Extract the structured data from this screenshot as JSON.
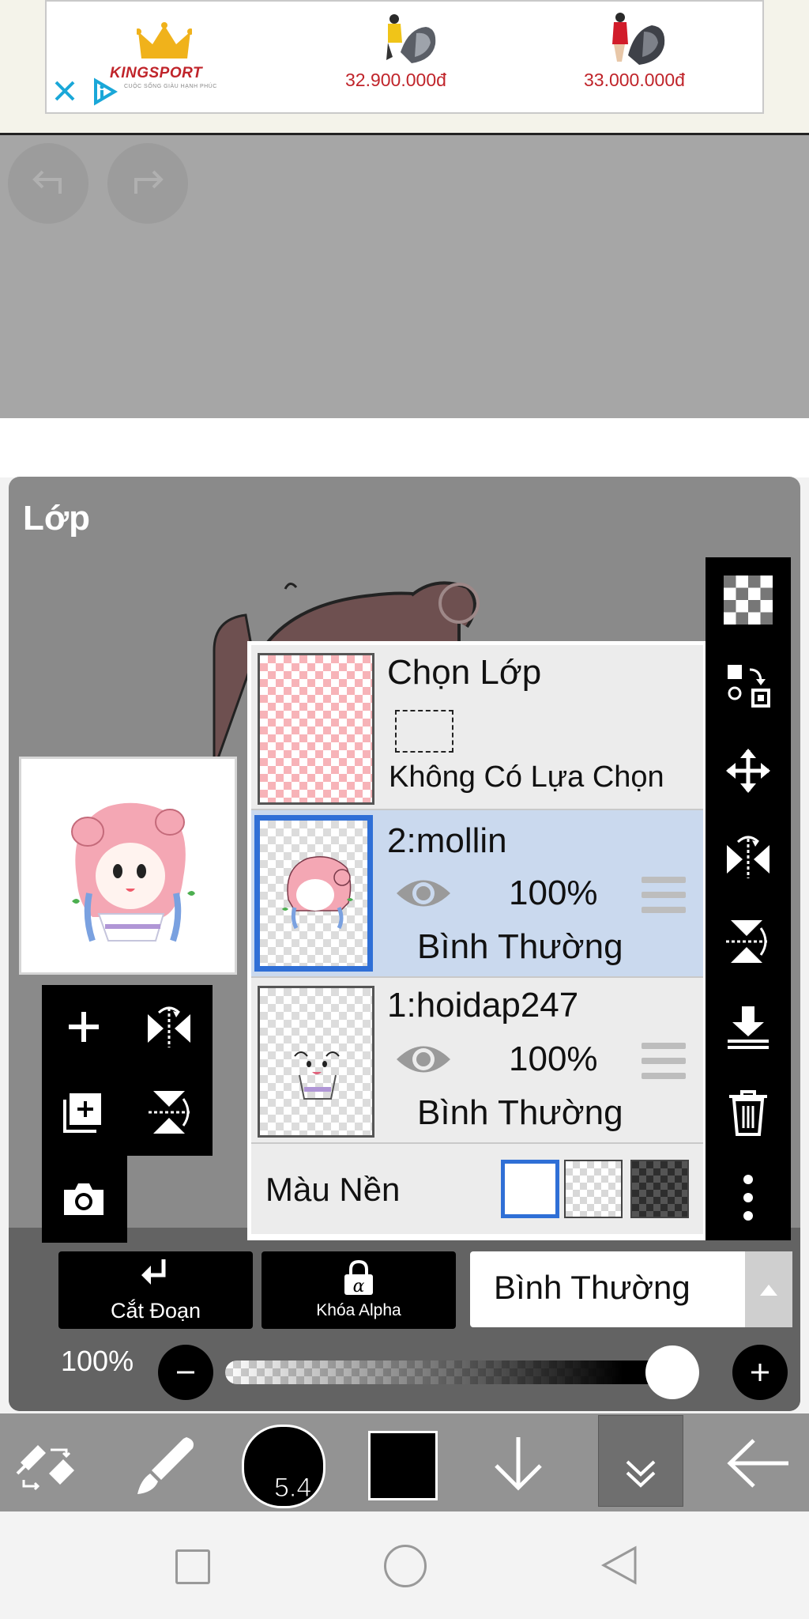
{
  "ad": {
    "brand": "KINGSPORT",
    "brand_tagline": "CUỘC SỐNG GIÀU HẠNH PHÚC",
    "products": [
      {
        "price": "32.900.000đ"
      },
      {
        "price": "33.000.000đ"
      }
    ]
  },
  "panel": {
    "title": "Lớp"
  },
  "layers": {
    "selection_row": {
      "name": "Chọn Lớp",
      "status": "Không Có Lựa Chọn"
    },
    "items": [
      {
        "name": "2:mollin",
        "opacity": "100%",
        "blend": "Bình Thường",
        "selected": true
      },
      {
        "name": "1:hoidap247",
        "opacity": "100%",
        "blend": "Bình Thường",
        "selected": false
      }
    ],
    "background_label": "Màu Nền"
  },
  "controls": {
    "clipping_label": "Cắt Đoạn",
    "alpha_lock_label": "Khóa Alpha",
    "blend_mode": "Bình Thường",
    "opacity_label": "100%",
    "opacity_value": 1.0
  },
  "bottom_toolbar": {
    "brush_size": "5.4",
    "current_color": "#000000"
  },
  "colors": {
    "accent": "#2f6fd6",
    "selected_row": "#cad9ee",
    "price": "#c0242a"
  }
}
